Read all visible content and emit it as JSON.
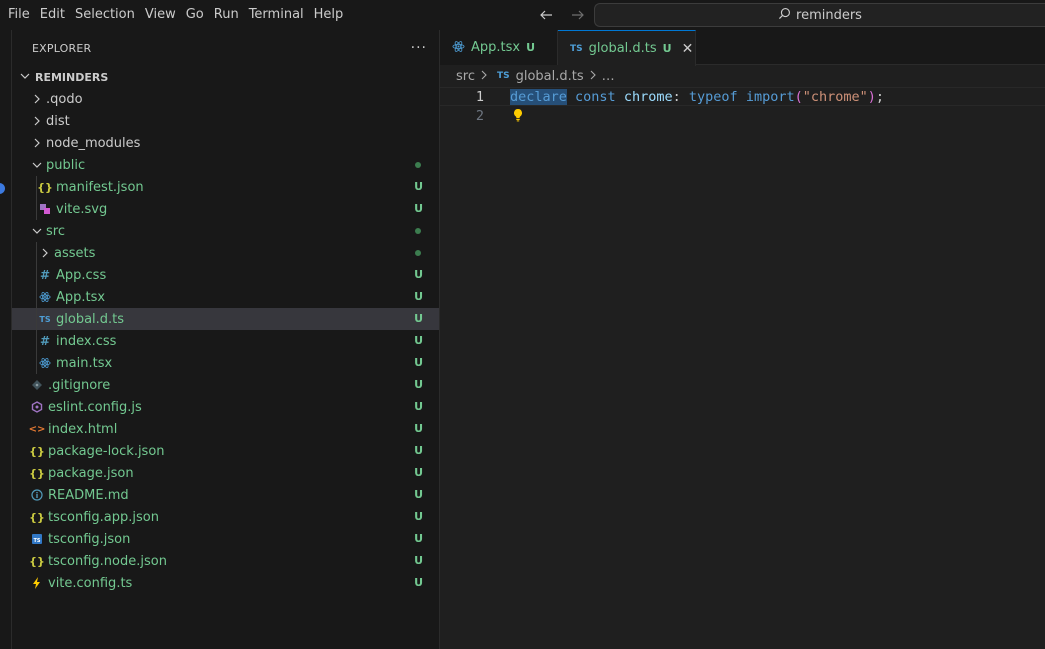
{
  "menubar": [
    "File",
    "Edit",
    "Selection",
    "View",
    "Go",
    "Run",
    "Terminal",
    "Help"
  ],
  "search": {
    "text": "reminders"
  },
  "explorer": {
    "title": "EXPLORER",
    "more": "···",
    "section": "REMINDERS",
    "items": [
      {
        "label": ".qodo",
        "type": "folder",
        "level": 0,
        "expanded": false,
        "color": "plain",
        "decoration": ""
      },
      {
        "label": "dist",
        "type": "folder",
        "level": 0,
        "expanded": false,
        "color": "plain",
        "decoration": ""
      },
      {
        "label": "node_modules",
        "type": "folder",
        "level": 0,
        "expanded": false,
        "color": "plain",
        "decoration": ""
      },
      {
        "label": "public",
        "type": "folder",
        "level": 0,
        "expanded": true,
        "color": "green",
        "decoration": "dot"
      },
      {
        "label": "manifest.json",
        "type": "json",
        "level": 1,
        "color": "green",
        "decoration": "U"
      },
      {
        "label": "vite.svg",
        "type": "svg",
        "level": 1,
        "color": "green",
        "decoration": "U"
      },
      {
        "label": "src",
        "type": "folder",
        "level": 0,
        "expanded": true,
        "color": "green",
        "decoration": "dot"
      },
      {
        "label": "assets",
        "type": "folder",
        "level": 1,
        "expanded": false,
        "color": "green",
        "decoration": "dot"
      },
      {
        "label": "App.css",
        "type": "css",
        "level": 1,
        "color": "green",
        "decoration": "U"
      },
      {
        "label": "App.tsx",
        "type": "react",
        "level": 1,
        "color": "green",
        "decoration": "U"
      },
      {
        "label": "global.d.ts",
        "type": "ts",
        "level": 1,
        "color": "green",
        "decoration": "U",
        "selected": true
      },
      {
        "label": "index.css",
        "type": "css",
        "level": 1,
        "color": "green",
        "decoration": "U"
      },
      {
        "label": "main.tsx",
        "type": "react",
        "level": 1,
        "color": "green",
        "decoration": "U"
      },
      {
        "label": ".gitignore",
        "type": "git",
        "level": 0,
        "color": "green",
        "decoration": "U"
      },
      {
        "label": "eslint.config.js",
        "type": "eslint",
        "level": 0,
        "color": "green",
        "decoration": "U"
      },
      {
        "label": "index.html",
        "type": "html",
        "level": 0,
        "color": "green",
        "decoration": "U"
      },
      {
        "label": "package-lock.json",
        "type": "json",
        "level": 0,
        "color": "green",
        "decoration": "U"
      },
      {
        "label": "package.json",
        "type": "json",
        "level": 0,
        "color": "green",
        "decoration": "U"
      },
      {
        "label": "README.md",
        "type": "info",
        "level": 0,
        "color": "green",
        "decoration": "U"
      },
      {
        "label": "tsconfig.app.json",
        "type": "json",
        "level": 0,
        "color": "green",
        "decoration": "U"
      },
      {
        "label": "tsconfig.json",
        "type": "tsconfig",
        "level": 0,
        "color": "green",
        "decoration": "U"
      },
      {
        "label": "tsconfig.node.json",
        "type": "json",
        "level": 0,
        "color": "green",
        "decoration": "U"
      },
      {
        "label": "vite.config.ts",
        "type": "vite",
        "level": 0,
        "color": "green",
        "decoration": "U"
      }
    ]
  },
  "tabs": [
    {
      "label": "App.tsx",
      "icon": "react-icon",
      "modified": "U",
      "active": false
    },
    {
      "label": "global.d.ts",
      "icon": "TS",
      "modified": "U",
      "active": true,
      "close": "✕"
    }
  ],
  "breadcrumbs": {
    "folder": "src",
    "ts_icon": "TS",
    "file": "global.d.ts",
    "more": "…"
  },
  "code": {
    "line_numbers": [
      "1",
      "2"
    ],
    "line1": {
      "declare": "declare",
      "const": "const",
      "chrome": "chrome",
      "colon": ":",
      "typeof": "typeof",
      "import": "import",
      "open": "(",
      "string": "\"chrome\"",
      "close": ")",
      "semi": ";"
    }
  },
  "colors": {
    "accent": "#0078d4",
    "git_untracked": "#73c991",
    "selection": "#264f78"
  }
}
